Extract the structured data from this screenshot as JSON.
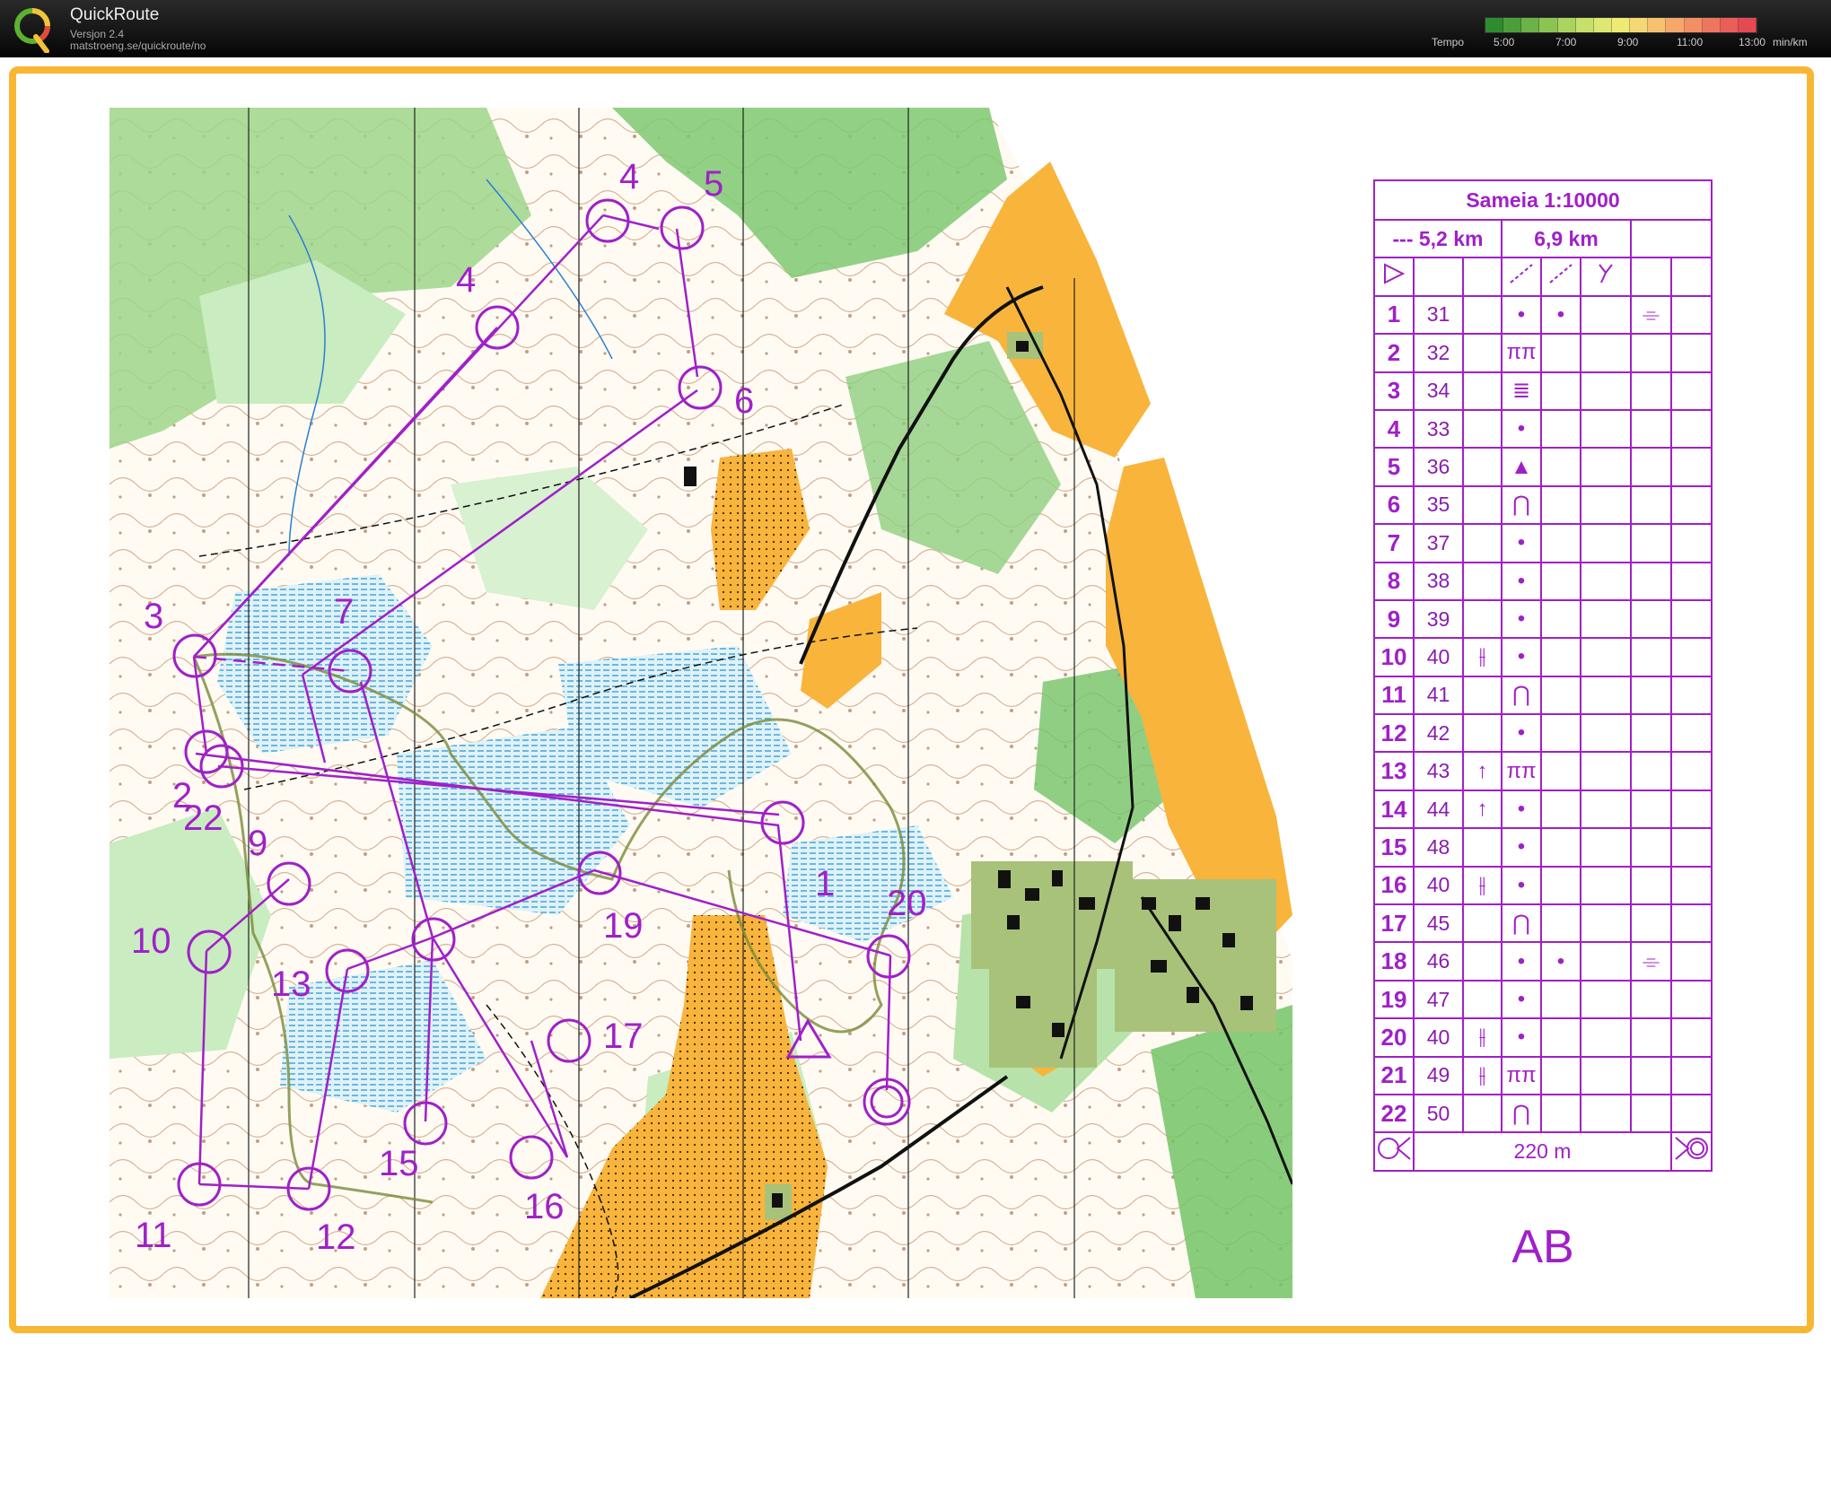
{
  "app": {
    "title": "QuickRoute",
    "version": "Versjon 2.4",
    "url": "matstroeng.se/quickroute/no"
  },
  "tempo": {
    "label": "Tempo",
    "ticks": [
      "5:00",
      "7:00",
      "9:00",
      "11:00",
      "13:00"
    ],
    "unit": "min/km",
    "colors": [
      "#2e8b2e",
      "#4c9e3a",
      "#6cb247",
      "#8cc454",
      "#aad460",
      "#c6e06a",
      "#dde872",
      "#eeeb74",
      "#f5d874",
      "#f7c270",
      "#f6a86a",
      "#f38f64",
      "#ef765e",
      "#ea5e58",
      "#e44a52"
    ]
  },
  "legend": {
    "title": "Sameia 1:10000",
    "length_dashed": "--- 5,2 km",
    "length_course": "6,9 km",
    "finish_distance": "220 m",
    "class_name": "AB",
    "rows": [
      {
        "num": "1",
        "code": "31",
        "d": "",
        "e": "•",
        "f": "•",
        "h": "⌯"
      },
      {
        "num": "2",
        "code": "32",
        "d": "",
        "e": "ππ",
        "f": "",
        "h": ""
      },
      {
        "num": "3",
        "code": "34",
        "d": "",
        "e": "≣",
        "f": "",
        "h": ""
      },
      {
        "num": "4",
        "code": "33",
        "d": "",
        "e": "•",
        "f": "",
        "h": ""
      },
      {
        "num": "5",
        "code": "36",
        "d": "",
        "e": "▲",
        "f": "",
        "h": ""
      },
      {
        "num": "6",
        "code": "35",
        "d": "",
        "e": "⋂",
        "f": "",
        "h": ""
      },
      {
        "num": "7",
        "code": "37",
        "d": "",
        "e": "•",
        "f": "",
        "h": ""
      },
      {
        "num": "8",
        "code": "38",
        "d": "",
        "e": "•",
        "f": "",
        "h": ""
      },
      {
        "num": "9",
        "code": "39",
        "d": "",
        "e": "•",
        "f": "",
        "h": ""
      },
      {
        "num": "10",
        "code": "40",
        "d": "⫲",
        "e": "•",
        "f": "",
        "h": ""
      },
      {
        "num": "11",
        "code": "41",
        "d": "",
        "e": "⋂",
        "f": "",
        "h": ""
      },
      {
        "num": "12",
        "code": "42",
        "d": "",
        "e": "•",
        "f": "",
        "h": ""
      },
      {
        "num": "13",
        "code": "43",
        "d": "↑",
        "e": "ππ",
        "f": "",
        "h": ""
      },
      {
        "num": "14",
        "code": "44",
        "d": "↑",
        "e": "•",
        "f": "",
        "h": ""
      },
      {
        "num": "15",
        "code": "48",
        "d": "",
        "e": "•",
        "f": "",
        "h": ""
      },
      {
        "num": "16",
        "code": "40",
        "d": "⫲",
        "e": "•",
        "f": "",
        "h": ""
      },
      {
        "num": "17",
        "code": "45",
        "d": "",
        "e": "⋂",
        "f": "",
        "h": ""
      },
      {
        "num": "18",
        "code": "46",
        "d": "",
        "e": "•",
        "f": "•",
        "h": "⌯"
      },
      {
        "num": "19",
        "code": "47",
        "d": "",
        "e": "•",
        "f": "",
        "h": ""
      },
      {
        "num": "20",
        "code": "40",
        "d": "⫲",
        "e": "•",
        "f": "",
        "h": ""
      },
      {
        "num": "21",
        "code": "49",
        "d": "⫲",
        "e": "ππ",
        "f": "",
        "h": ""
      },
      {
        "num": "22",
        "code": "50",
        "d": "",
        "e": "⋂",
        "f": "",
        "h": ""
      }
    ]
  },
  "map": {
    "controls": [
      {
        "label": "1"
      },
      {
        "label": "2"
      },
      {
        "label": "3"
      },
      {
        "label": "4"
      },
      {
        "label": "5"
      },
      {
        "label": "6"
      },
      {
        "label": "7"
      },
      {
        "label": "9"
      },
      {
        "label": "10"
      },
      {
        "label": "11"
      },
      {
        "label": "12"
      },
      {
        "label": "13"
      },
      {
        "label": "15"
      },
      {
        "label": "16"
      },
      {
        "label": "17"
      },
      {
        "label": "19"
      },
      {
        "label": "20"
      },
      {
        "label": "22"
      },
      {
        "label": "4"
      }
    ]
  }
}
